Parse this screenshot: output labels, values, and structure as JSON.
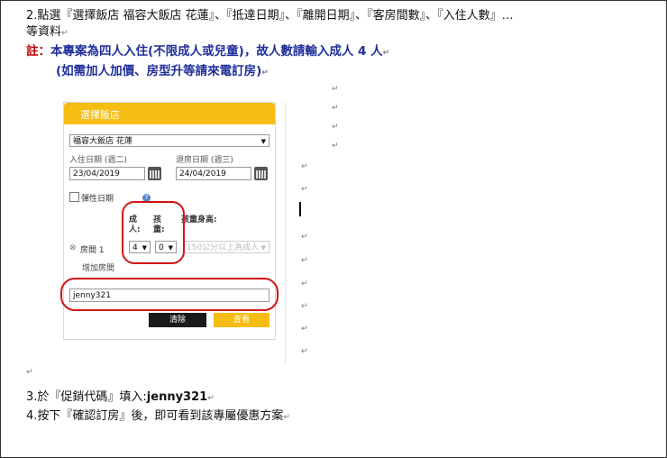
{
  "document": {
    "step2_line1": "2.點選『選擇飯店  福容大飯店 花蓮』、『抵達日期』、『離開日期』、『客房間數』、『入住人數』…",
    "step2_line2": "等資料",
    "note_label": "註：",
    "note_line1": "本專案為四人入住(不限成人或兒童)，故人數請輸入成人 4 人",
    "note_line2": "(如需加人加價、房型升等請來電訂房)",
    "step3_prefix": "3.於『促銷代碼』填入:",
    "step3_code": "jenny321",
    "step4": "4.按下『確認訂房』後，即可看到該專屬優惠方案",
    "para_mark": "↵",
    "arrow_mark": "↲"
  },
  "widget": {
    "title": "選擇飯店",
    "hotel": "福容大飯店 花蓮",
    "checkin_label": "入住日期 (週二)",
    "checkin_value": "23/04/2019",
    "checkout_label": "退房日期 (週三)",
    "checkout_value": "24/04/2019",
    "flex_label": "彈性日期",
    "help_glyph": "?",
    "adults_label_1": "成",
    "adults_label_2": "人:",
    "children_label_1": "孩",
    "children_label_2": "童:",
    "child_height_label": "孩童身高:",
    "room_label": "房間 1",
    "remove_glyph": "⊗",
    "adults_value": "4",
    "children_value": "0",
    "height_value": "150公分以上為成人",
    "add_room": "增加房間",
    "promo_value": "jenny321",
    "clear_button": "清除",
    "view_button": "查看",
    "caret": "▼"
  },
  "colors": {
    "header": "#f6bd12",
    "highlight": "#d21414",
    "note_text": "#1f2f9a"
  }
}
